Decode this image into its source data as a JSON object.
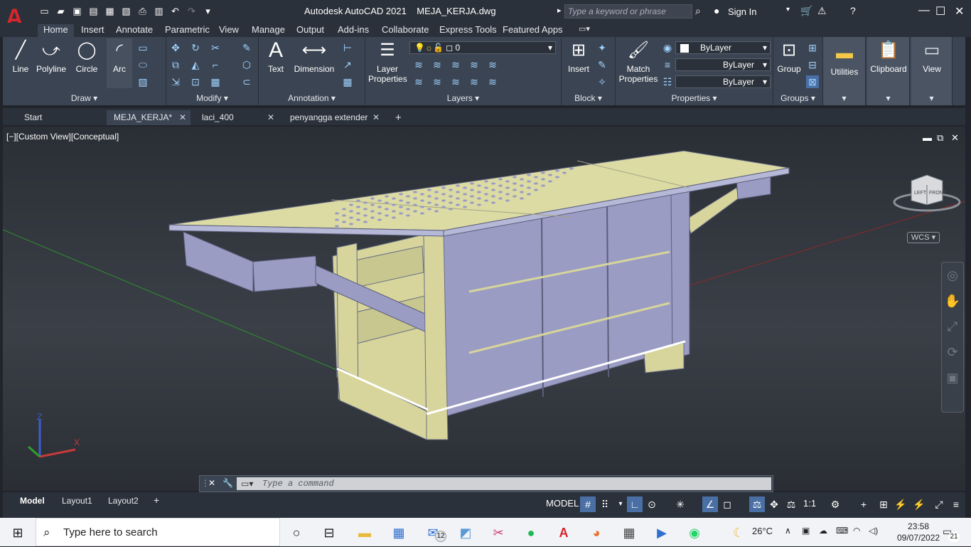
{
  "app": {
    "title": "Autodesk AutoCAD 2021",
    "filename": "MEJA_KERJA.dwg",
    "logo": "A",
    "search_placeholder": "Type a keyword or phrase",
    "sign_in": "Sign In",
    "accent": "#d7262c"
  },
  "ribbon_tabs": [
    "Home",
    "Insert",
    "Annotate",
    "Parametric",
    "View",
    "Manage",
    "Output",
    "Add-ins",
    "Collaborate",
    "Express Tools",
    "Featured Apps"
  ],
  "panels": {
    "draw": {
      "label": "Draw",
      "tools": [
        "Line",
        "Polyline",
        "Circle",
        "Arc"
      ]
    },
    "modify": {
      "label": "Modify"
    },
    "annotation": {
      "label": "Annotation",
      "tools": [
        "Text",
        "Dimension"
      ]
    },
    "layers": {
      "label": "Layers",
      "tool": "Layer Properties",
      "current_layer": "0"
    },
    "block": {
      "label": "Block",
      "tool": "Insert"
    },
    "properties": {
      "label": "Properties",
      "tool": "Match Properties",
      "color": "ByLayer",
      "linetype": "ByLayer",
      "lineweight": "ByLayer"
    },
    "groups": {
      "label": "Groups",
      "tool": "Group"
    },
    "utilities": {
      "label": "Utilities"
    },
    "clipboard": {
      "label": "Clipboard"
    },
    "view": {
      "label": "View"
    }
  },
  "doc_tabs": [
    {
      "label": "Start",
      "active": false
    },
    {
      "label": "MEJA_KERJA*",
      "active": true
    },
    {
      "label": "laci_400",
      "active": false
    },
    {
      "label": "penyangga extender",
      "active": false
    }
  ],
  "viewport": {
    "label": "[−][Custom View][Conceptual]",
    "wcs": "WCS",
    "cube_left": "LEFT",
    "cube_front": "FRONT",
    "axis_z": "Z",
    "axis_x": "X"
  },
  "command": {
    "placeholder": "Type a command"
  },
  "layouts": [
    "Model",
    "Layout1",
    "Layout2"
  ],
  "status": {
    "model": "MODEL",
    "scale": "1:1"
  },
  "taskbar": {
    "search": "Type here to search",
    "mail_badge": "12",
    "weather": "26°C",
    "time": "23:58",
    "date": "09/07/2022",
    "notifications": "21"
  }
}
